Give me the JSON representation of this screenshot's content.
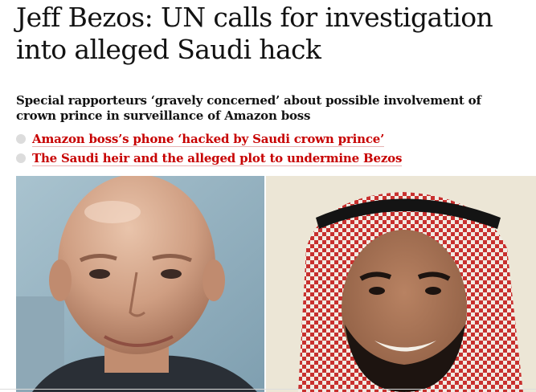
{
  "article": {
    "headline": "Jeff Bezos: UN calls for investigation into alleged Saudi hack",
    "standfirst": "Special rapporteurs ‘gravely concerned’ about possible involvement of crown prince in surveillance of Amazon boss",
    "related_links": [
      {
        "label": "Amazon boss’s phone ‘hacked by Saudi crown prince’"
      },
      {
        "label": "The Saudi heir and the alleged plot to undermine Bezos"
      }
    ]
  },
  "colors": {
    "headline": "#121212",
    "link": "#c70000",
    "bullet": "#dcdcdc"
  }
}
